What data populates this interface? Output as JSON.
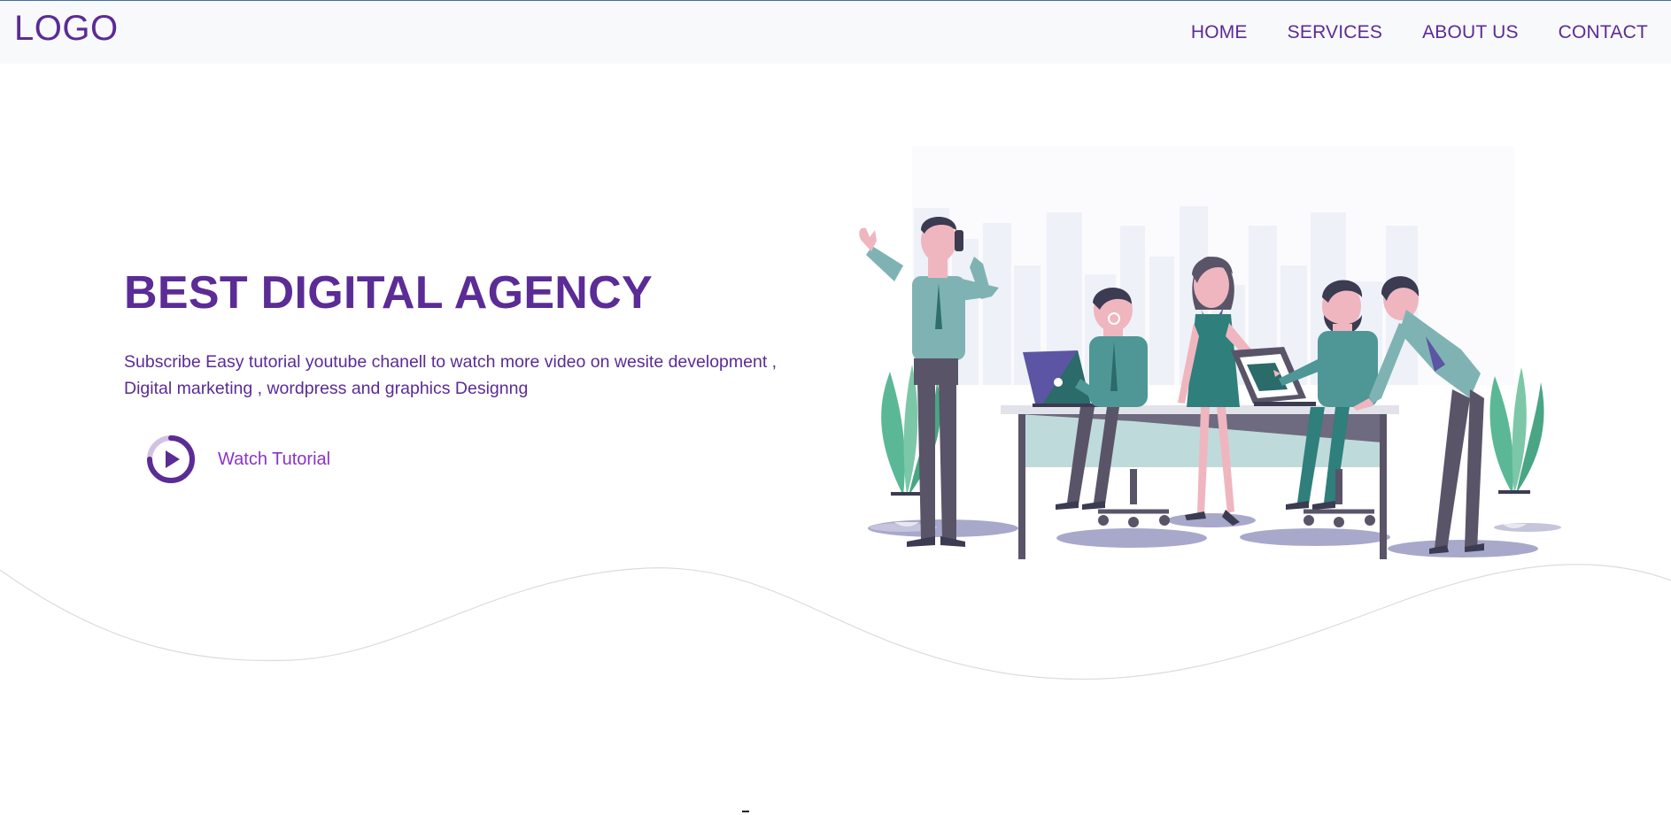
{
  "navbar": {
    "logo": "LOGO",
    "links": [
      {
        "label": "HOME"
      },
      {
        "label": "SERVICES"
      },
      {
        "label": "ABOUT US"
      },
      {
        "label": "CONTACT"
      }
    ]
  },
  "hero": {
    "title": "BEST DIGITAL AGENCY",
    "subtitle_line1": "Subscribe Easy tutorial youtube chanell to watch more video on wesite development ,",
    "subtitle_line2": "Digital marketing , wordpress and graphics Designng",
    "watch_label": "Watch Tutorial"
  },
  "colors": {
    "brand_purple": "#5b2b96",
    "accent_purple": "#8a33c9",
    "navbar_bg": "#f8f9fa",
    "teal": "#2f7f7c",
    "slate": "#5a5468"
  },
  "icons": {
    "play": "play-circle-icon"
  }
}
